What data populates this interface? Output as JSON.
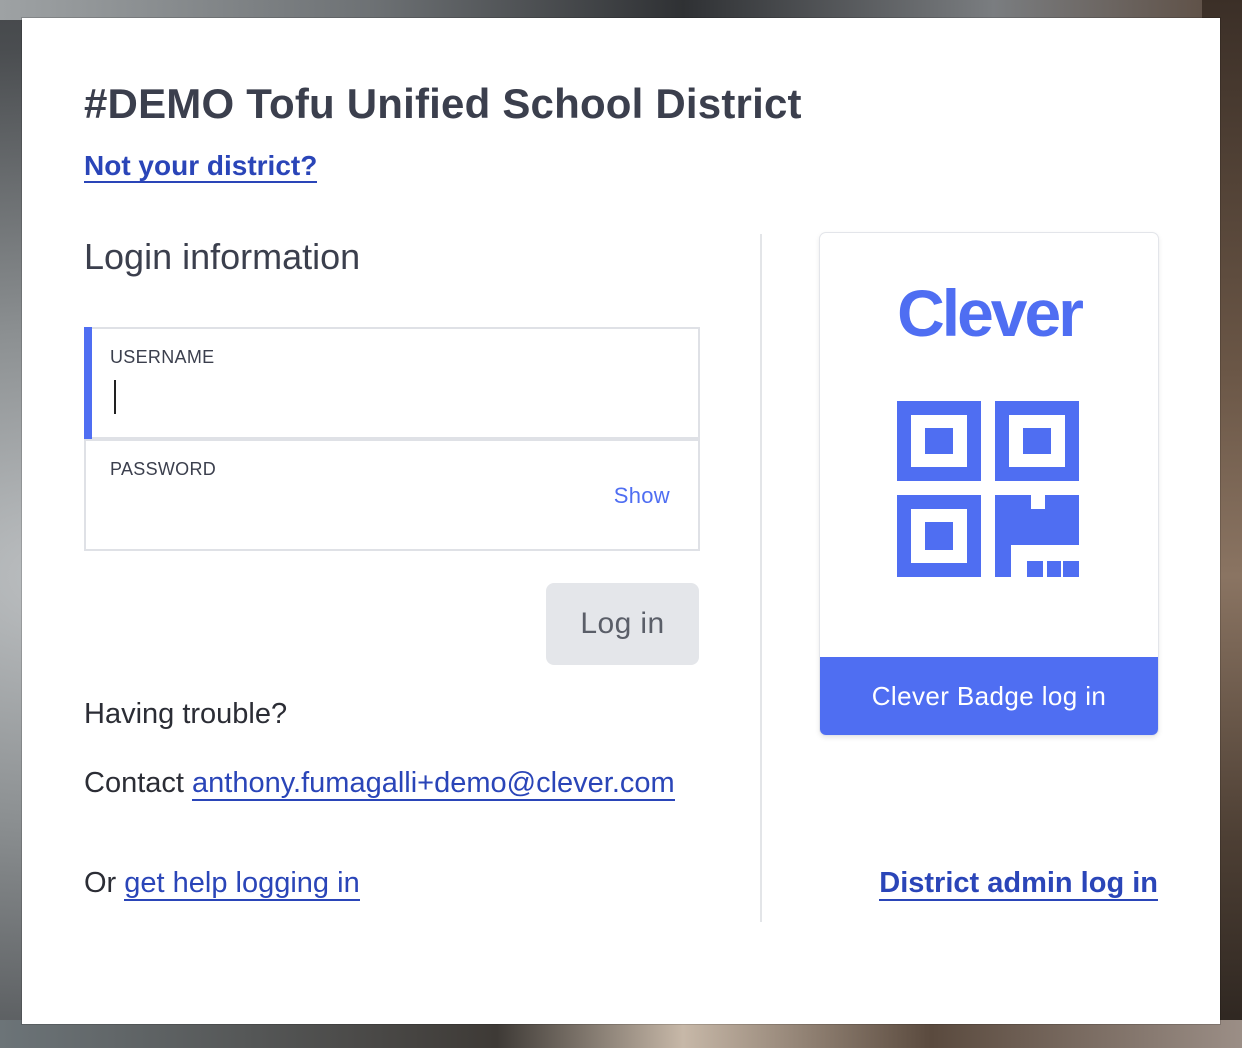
{
  "district": {
    "title": "#DEMO Tofu Unified School District",
    "not_your_district": "Not your district?"
  },
  "login": {
    "heading": "Login information",
    "username_label": "USERNAME",
    "username_value": "",
    "password_label": "PASSWORD",
    "password_value": "",
    "show_label": "Show",
    "submit_label": "Log in"
  },
  "help": {
    "trouble_text": "Having trouble?",
    "contact_prefix": "Contact ",
    "contact_email": "anthony.fumagalli+demo@clever.com",
    "or_prefix": "Or ",
    "help_link": "get help logging in"
  },
  "badge": {
    "logo_text": "Clever",
    "icon": "qr-code-icon",
    "button_label": "Clever Badge log in"
  },
  "admin": {
    "link_label": "District admin log in"
  },
  "colors": {
    "brand_blue": "#4f6ef2",
    "link_blue": "#2a45b8",
    "heading_text": "#3b3f4d",
    "button_gray": "#e4e6ea"
  }
}
